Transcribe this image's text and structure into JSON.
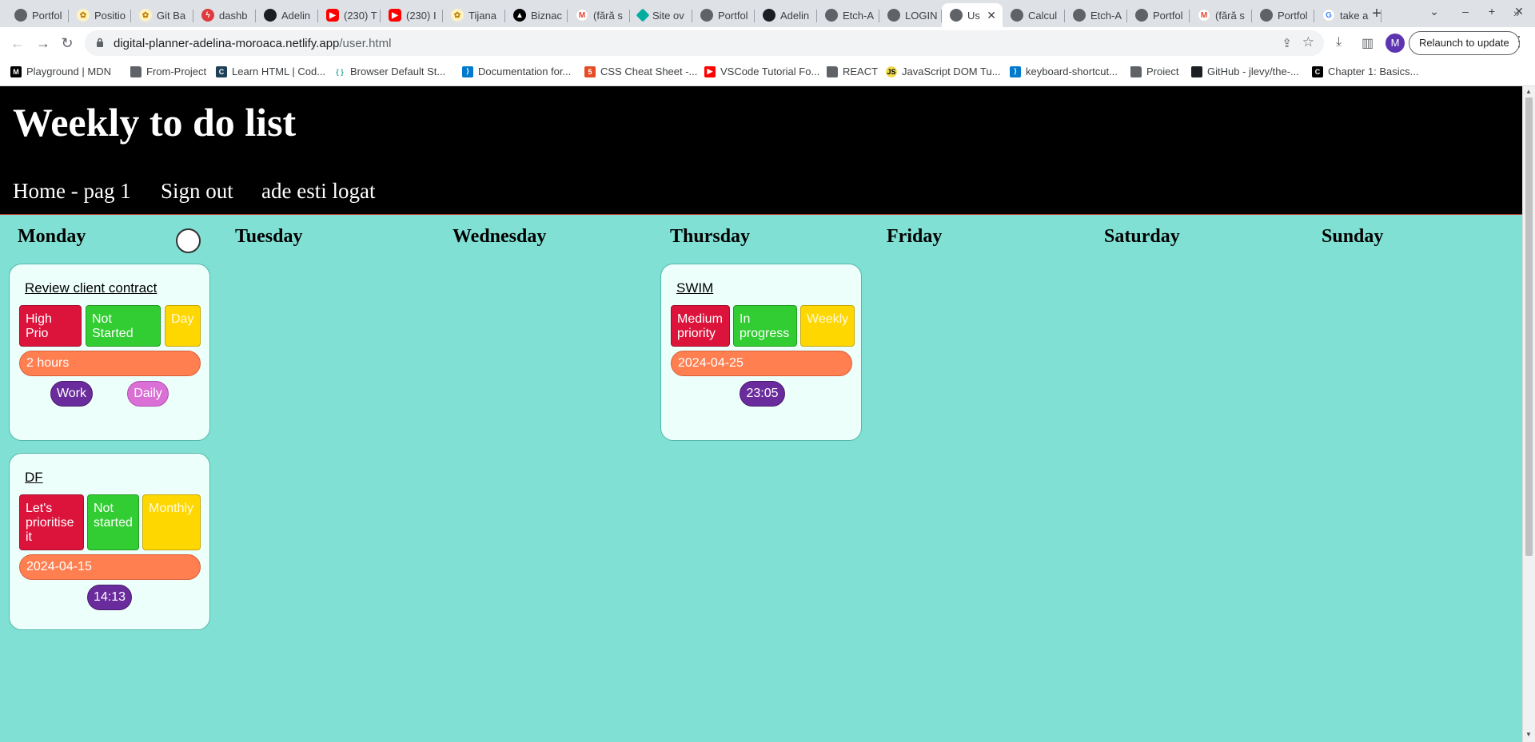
{
  "browser": {
    "tabs": [
      {
        "label": "Portfol",
        "icon": "globe"
      },
      {
        "label": "Positio",
        "icon": "extension"
      },
      {
        "label": "Git Ba",
        "icon": "extension"
      },
      {
        "label": "dashb",
        "icon": "dashboard"
      },
      {
        "label": "Adelin",
        "icon": "github"
      },
      {
        "label": "(230) T",
        "icon": "youtube"
      },
      {
        "label": "(230) I",
        "icon": "youtube"
      },
      {
        "label": "Tijana",
        "icon": "extension"
      },
      {
        "label": "Biznac",
        "icon": "triangle"
      },
      {
        "label": "(fără s",
        "icon": "gmail"
      },
      {
        "label": "Site ov",
        "icon": "netlify"
      },
      {
        "label": "Portfol",
        "icon": "globe"
      },
      {
        "label": "Adelin",
        "icon": "github"
      },
      {
        "label": "Etch-A",
        "icon": "globe"
      },
      {
        "label": "LOGIN",
        "icon": "globe"
      },
      {
        "label": "Us",
        "icon": "globe",
        "active": true
      },
      {
        "label": "Calcul",
        "icon": "globe"
      },
      {
        "label": "Etch-A",
        "icon": "globe"
      },
      {
        "label": "Portfol",
        "icon": "globe"
      },
      {
        "label": "(fără s",
        "icon": "gmail"
      },
      {
        "label": "Portfol",
        "icon": "globe"
      },
      {
        "label": "take a",
        "icon": "google"
      }
    ],
    "url_host": "digital-planner-adelina-moroaca.netlify.app",
    "url_path": "/user.html",
    "avatar_letter": "M",
    "relaunch_label": "Relaunch to update",
    "bookmarks": [
      {
        "label": "Playground | MDN",
        "icon": "mdn"
      },
      {
        "label": "From-Project",
        "icon": "folder"
      },
      {
        "label": "Learn HTML | Cod...",
        "icon": "codecademy"
      },
      {
        "label": "Browser Default St...",
        "icon": "braces"
      },
      {
        "label": "Documentation for...",
        "icon": "vscode"
      },
      {
        "label": "CSS Cheat Sheet -...",
        "icon": "html5"
      },
      {
        "label": "VSCode Tutorial Fo...",
        "icon": "youtube"
      },
      {
        "label": "REACT",
        "icon": "folder"
      },
      {
        "label": "JavaScript DOM Tu...",
        "icon": "js"
      },
      {
        "label": "keyboard-shortcut...",
        "icon": "vscode"
      },
      {
        "label": "Proiect",
        "icon": "folder"
      },
      {
        "label": "GitHub - jlevy/the-...",
        "icon": "github"
      },
      {
        "label": "Chapter 1: Basics...",
        "icon": "chapter"
      }
    ]
  },
  "site": {
    "title": "Weekly to do list",
    "nav": {
      "home": "Home - pag 1",
      "signout": "Sign out",
      "status": "ade esti logat"
    }
  },
  "days": [
    "Monday",
    "Tuesday",
    "Wednesday",
    "Thursday",
    "Friday",
    "Saturday",
    "Sunday"
  ],
  "tasks": {
    "monday_1": {
      "title": "Review client contract",
      "priority": "High Prio",
      "status": "Not Started",
      "period": "Day",
      "due": "2 hours",
      "category": "Work",
      "frequency": "Daily"
    },
    "monday_2": {
      "title": "DF",
      "priority": "Let's prioritise it",
      "status": "Not started",
      "period": "Monthly",
      "due": "2024-04-15",
      "time": "14:13"
    },
    "thursday_1": {
      "title": "SWIM",
      "priority": "Medium priority",
      "status": "In progress",
      "period": "Weekly",
      "due": "2024-04-25",
      "time": "23:05"
    }
  },
  "colors": {
    "page_bg": "#80e0d4",
    "header_bg": "#000000",
    "card_bg": "#edfffb",
    "priority": "#dc143c",
    "status": "#32cd32",
    "period": "#ffd700",
    "due": "#ff7f50",
    "time": "#6a2c9c",
    "frequency": "#da70d6"
  }
}
